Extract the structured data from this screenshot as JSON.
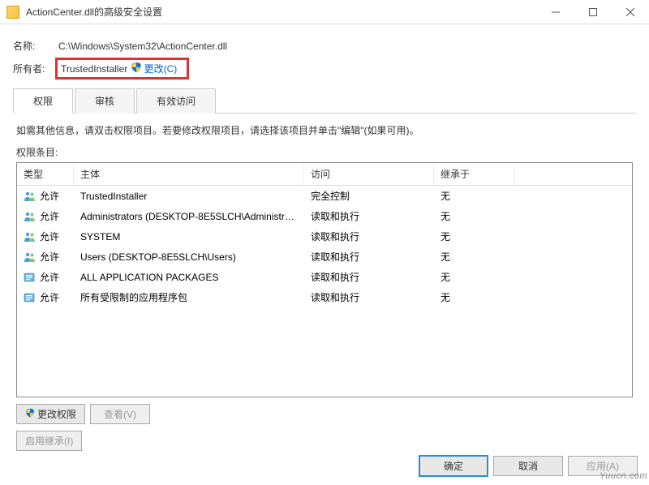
{
  "titlebar": {
    "title": "ActionCenter.dll的高级安全设置"
  },
  "info": {
    "name_label": "名称:",
    "name_value": "C:\\Windows\\System32\\ActionCenter.dll",
    "owner_label": "所有者:",
    "owner_value": "TrustedInstaller",
    "change_label": "更改(C)"
  },
  "tabs": [
    {
      "label": "权限",
      "active": true
    },
    {
      "label": "审核",
      "active": false
    },
    {
      "label": "有效访问",
      "active": false
    }
  ],
  "help_text": "如需其他信息，请双击权限项目。若要修改权限项目，请选择该项目并单击\"编辑\"(如果可用)。",
  "entries_label": "权限条目:",
  "columns": {
    "type": "类型",
    "principal": "主体",
    "access": "访问",
    "inherit": "继承于"
  },
  "rows": [
    {
      "icon": "users",
      "type": "允许",
      "principal": "TrustedInstaller",
      "access": "完全控制",
      "inherit": "无"
    },
    {
      "icon": "users",
      "type": "允许",
      "principal": "Administrators (DESKTOP-8E5SLCH\\Administrat...",
      "access": "读取和执行",
      "inherit": "无"
    },
    {
      "icon": "users",
      "type": "允许",
      "principal": "SYSTEM",
      "access": "读取和执行",
      "inherit": "无"
    },
    {
      "icon": "users",
      "type": "允许",
      "principal": "Users (DESKTOP-8E5SLCH\\Users)",
      "access": "读取和执行",
      "inherit": "无"
    },
    {
      "icon": "pkg",
      "type": "允许",
      "principal": "ALL APPLICATION PACKAGES",
      "access": "读取和执行",
      "inherit": "无"
    },
    {
      "icon": "pkg",
      "type": "允许",
      "principal": "所有受限制的应用程序包",
      "access": "读取和执行",
      "inherit": "无"
    }
  ],
  "buttons": {
    "change_perm": "更改权限",
    "view": "查看(V)",
    "enable_inherit": "启用继承(I)",
    "ok": "确定",
    "cancel": "取消",
    "apply": "应用(A)"
  },
  "watermark": "Yuucn.com"
}
